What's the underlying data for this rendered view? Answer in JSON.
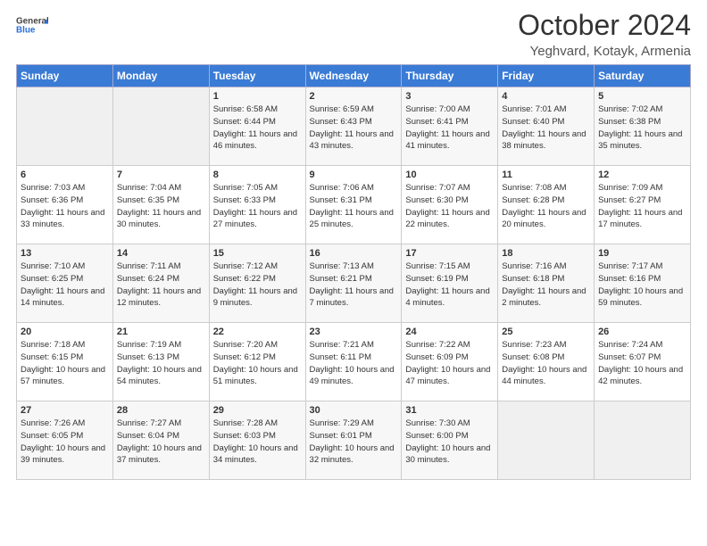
{
  "header": {
    "logo_general": "General",
    "logo_blue": "Blue",
    "month_year": "October 2024",
    "location": "Yeghvard, Kotayk, Armenia"
  },
  "weekdays": [
    "Sunday",
    "Monday",
    "Tuesday",
    "Wednesday",
    "Thursday",
    "Friday",
    "Saturday"
  ],
  "weeks": [
    [
      {
        "day": "",
        "info": ""
      },
      {
        "day": "",
        "info": ""
      },
      {
        "day": "1",
        "info": "Sunrise: 6:58 AM\nSunset: 6:44 PM\nDaylight: 11 hours and 46 minutes."
      },
      {
        "day": "2",
        "info": "Sunrise: 6:59 AM\nSunset: 6:43 PM\nDaylight: 11 hours and 43 minutes."
      },
      {
        "day": "3",
        "info": "Sunrise: 7:00 AM\nSunset: 6:41 PM\nDaylight: 11 hours and 41 minutes."
      },
      {
        "day": "4",
        "info": "Sunrise: 7:01 AM\nSunset: 6:40 PM\nDaylight: 11 hours and 38 minutes."
      },
      {
        "day": "5",
        "info": "Sunrise: 7:02 AM\nSunset: 6:38 PM\nDaylight: 11 hours and 35 minutes."
      }
    ],
    [
      {
        "day": "6",
        "info": "Sunrise: 7:03 AM\nSunset: 6:36 PM\nDaylight: 11 hours and 33 minutes."
      },
      {
        "day": "7",
        "info": "Sunrise: 7:04 AM\nSunset: 6:35 PM\nDaylight: 11 hours and 30 minutes."
      },
      {
        "day": "8",
        "info": "Sunrise: 7:05 AM\nSunset: 6:33 PM\nDaylight: 11 hours and 27 minutes."
      },
      {
        "day": "9",
        "info": "Sunrise: 7:06 AM\nSunset: 6:31 PM\nDaylight: 11 hours and 25 minutes."
      },
      {
        "day": "10",
        "info": "Sunrise: 7:07 AM\nSunset: 6:30 PM\nDaylight: 11 hours and 22 minutes."
      },
      {
        "day": "11",
        "info": "Sunrise: 7:08 AM\nSunset: 6:28 PM\nDaylight: 11 hours and 20 minutes."
      },
      {
        "day": "12",
        "info": "Sunrise: 7:09 AM\nSunset: 6:27 PM\nDaylight: 11 hours and 17 minutes."
      }
    ],
    [
      {
        "day": "13",
        "info": "Sunrise: 7:10 AM\nSunset: 6:25 PM\nDaylight: 11 hours and 14 minutes."
      },
      {
        "day": "14",
        "info": "Sunrise: 7:11 AM\nSunset: 6:24 PM\nDaylight: 11 hours and 12 minutes."
      },
      {
        "day": "15",
        "info": "Sunrise: 7:12 AM\nSunset: 6:22 PM\nDaylight: 11 hours and 9 minutes."
      },
      {
        "day": "16",
        "info": "Sunrise: 7:13 AM\nSunset: 6:21 PM\nDaylight: 11 hours and 7 minutes."
      },
      {
        "day": "17",
        "info": "Sunrise: 7:15 AM\nSunset: 6:19 PM\nDaylight: 11 hours and 4 minutes."
      },
      {
        "day": "18",
        "info": "Sunrise: 7:16 AM\nSunset: 6:18 PM\nDaylight: 11 hours and 2 minutes."
      },
      {
        "day": "19",
        "info": "Sunrise: 7:17 AM\nSunset: 6:16 PM\nDaylight: 10 hours and 59 minutes."
      }
    ],
    [
      {
        "day": "20",
        "info": "Sunrise: 7:18 AM\nSunset: 6:15 PM\nDaylight: 10 hours and 57 minutes."
      },
      {
        "day": "21",
        "info": "Sunrise: 7:19 AM\nSunset: 6:13 PM\nDaylight: 10 hours and 54 minutes."
      },
      {
        "day": "22",
        "info": "Sunrise: 7:20 AM\nSunset: 6:12 PM\nDaylight: 10 hours and 51 minutes."
      },
      {
        "day": "23",
        "info": "Sunrise: 7:21 AM\nSunset: 6:11 PM\nDaylight: 10 hours and 49 minutes."
      },
      {
        "day": "24",
        "info": "Sunrise: 7:22 AM\nSunset: 6:09 PM\nDaylight: 10 hours and 47 minutes."
      },
      {
        "day": "25",
        "info": "Sunrise: 7:23 AM\nSunset: 6:08 PM\nDaylight: 10 hours and 44 minutes."
      },
      {
        "day": "26",
        "info": "Sunrise: 7:24 AM\nSunset: 6:07 PM\nDaylight: 10 hours and 42 minutes."
      }
    ],
    [
      {
        "day": "27",
        "info": "Sunrise: 7:26 AM\nSunset: 6:05 PM\nDaylight: 10 hours and 39 minutes."
      },
      {
        "day": "28",
        "info": "Sunrise: 7:27 AM\nSunset: 6:04 PM\nDaylight: 10 hours and 37 minutes."
      },
      {
        "day": "29",
        "info": "Sunrise: 7:28 AM\nSunset: 6:03 PM\nDaylight: 10 hours and 34 minutes."
      },
      {
        "day": "30",
        "info": "Sunrise: 7:29 AM\nSunset: 6:01 PM\nDaylight: 10 hours and 32 minutes."
      },
      {
        "day": "31",
        "info": "Sunrise: 7:30 AM\nSunset: 6:00 PM\nDaylight: 10 hours and 30 minutes."
      },
      {
        "day": "",
        "info": ""
      },
      {
        "day": "",
        "info": ""
      }
    ]
  ]
}
